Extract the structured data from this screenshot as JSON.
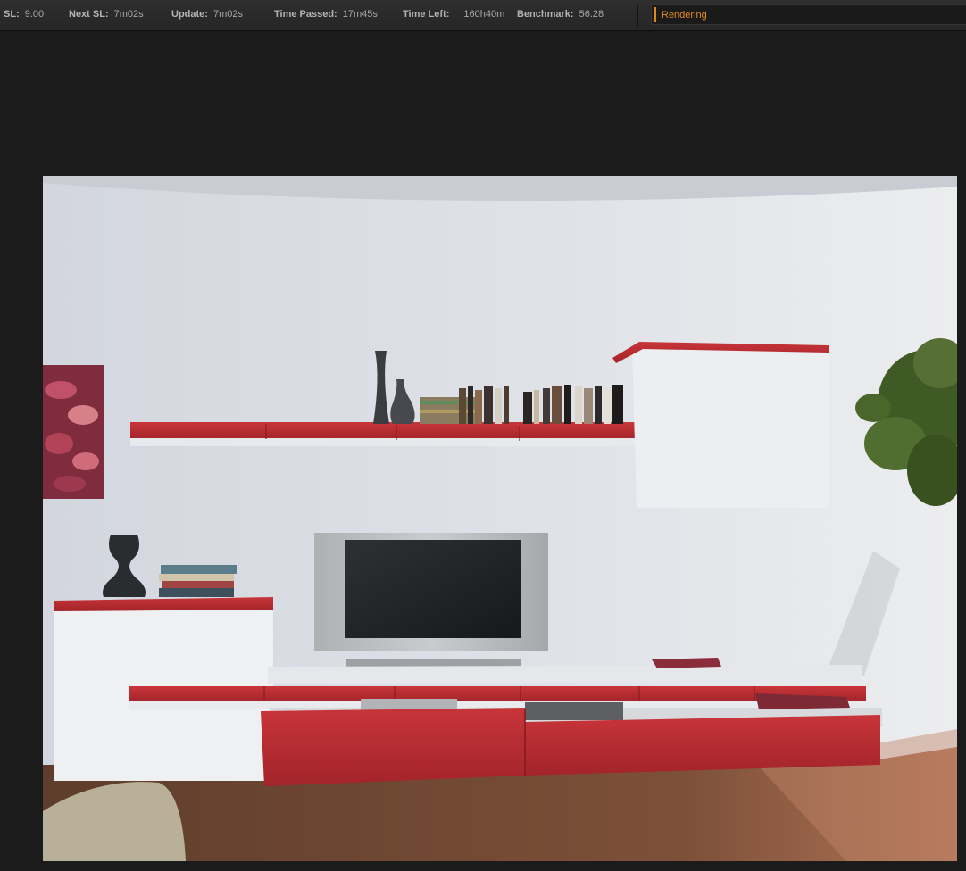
{
  "status": {
    "sl": {
      "label": "SL:",
      "value": "9.00"
    },
    "next_sl": {
      "label": "Next SL:",
      "value": "7m02s"
    },
    "update": {
      "label": "Update:",
      "value": "7m02s"
    },
    "time_passed": {
      "label": "Time Passed:",
      "value": "17m45s"
    },
    "time_left": {
      "label": "Time Left:",
      "value": "160h40m"
    },
    "benchmark": {
      "label": "Benchmark:",
      "value": "56.28"
    }
  },
  "progress": {
    "text": "Rendering",
    "color": "#e08a1e"
  },
  "render": {
    "scene": "living-room-tv-wall-unit",
    "wall_color": "#dfe2e7",
    "accent_color": "#b8282b",
    "floor_color": "#7a4a34"
  }
}
